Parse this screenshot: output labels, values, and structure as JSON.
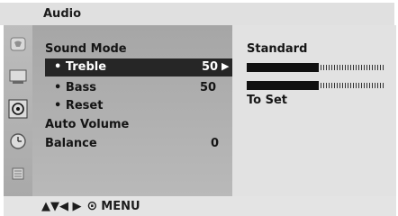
{
  "menu": {
    "title": "Audio"
  },
  "left": {
    "items": [
      {
        "label": "Sound Mode",
        "value": ""
      },
      {
        "label": "• Treble",
        "value": "50"
      },
      {
        "label": "• Bass",
        "value": "50"
      },
      {
        "label": "• Reset",
        "value": ""
      },
      {
        "label": "Auto Volume",
        "value": ""
      },
      {
        "label": "Balance",
        "value": "0"
      }
    ],
    "selected_arrow": "▶"
  },
  "right": {
    "mode": "Standard",
    "bars": [
      {
        "level": 0.52
      },
      {
        "level": 0.52
      }
    ],
    "hint": "To Set"
  },
  "footer": {
    "nav_arrows": "▲▼◀ ▶",
    "ok_symbol": "⊙",
    "menu_label": "MENU"
  },
  "icons": {
    "sidebar": [
      "picture-icon",
      "screen-icon",
      "audio-icon",
      "time-icon",
      "lock-icon"
    ]
  },
  "colors": {
    "highlight_bg": "#262626",
    "highlight_text": "#ffffff",
    "panel_bg": "#b0b0b0",
    "detail_bg": "#e2e2e2"
  }
}
